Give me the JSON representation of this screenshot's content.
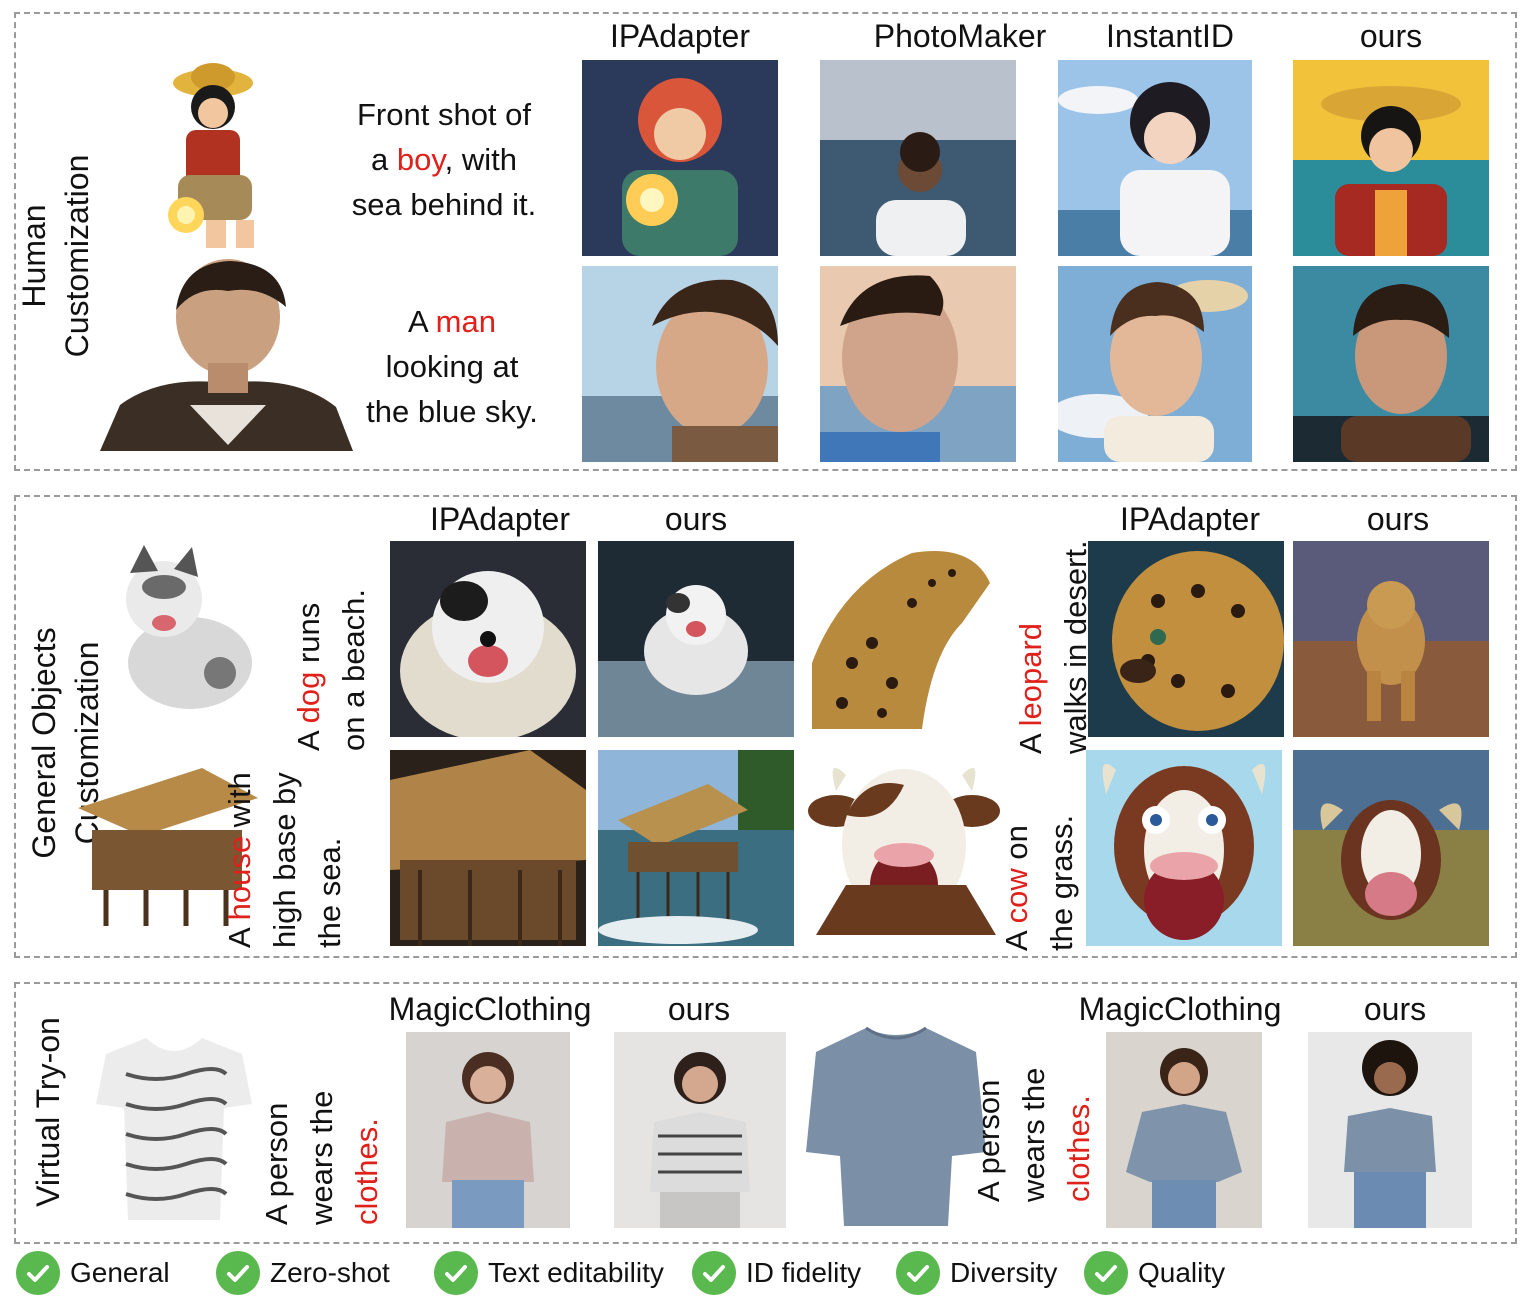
{
  "human": {
    "section_label_1": "Human",
    "section_label_2": "Customization",
    "columns": [
      "IPAdapter",
      "PhotoMaker",
      "InstantID",
      "ours"
    ],
    "prompt1_line1": "Front shot of",
    "prompt1_pre": "a ",
    "prompt1_hl": "boy",
    "prompt1_post": ",   with",
    "prompt1_line3": "sea behind it.",
    "prompt2_pre": "A ",
    "prompt2_hl": "man",
    "prompt2_line2": "looking at",
    "prompt2_line3": "the blue sky."
  },
  "objects": {
    "section_label_1": "General Objects",
    "section_label_2": "Customization",
    "left_columns": [
      "IPAdapter",
      "ours"
    ],
    "right_columns": [
      "IPAdapter",
      "ours"
    ],
    "dog_pre": "A ",
    "dog_hl": "dog",
    "dog_post": " runs",
    "dog_line2": "on a beach.",
    "house_pre": "A ",
    "house_hl": "house",
    "house_post": " with",
    "house_line2": "high base by",
    "house_line3": "the sea.",
    "leopard_pre": "A ",
    "leopard_hl": "leopard",
    "leopard_line2": "walks in desert.",
    "cow_pre": "A ",
    "cow_hl": "cow",
    "cow_post": " on",
    "cow_line2": "the grass."
  },
  "tryon": {
    "section_label": "Virtual Try-on",
    "left_columns": [
      "MagicClothing",
      "ours"
    ],
    "right_columns": [
      "MagicClothing",
      "ours"
    ],
    "prompt_line1": "A person",
    "prompt_line2": "wears the",
    "prompt_hl": "clothes."
  },
  "legend": [
    "General",
    "Zero-shot",
    "Text editability",
    "ID fidelity",
    "Diversity",
    "Quality"
  ],
  "colors": {
    "highlight": "#e0201a",
    "check": "#59b84e",
    "border": "#9a9a9a"
  }
}
